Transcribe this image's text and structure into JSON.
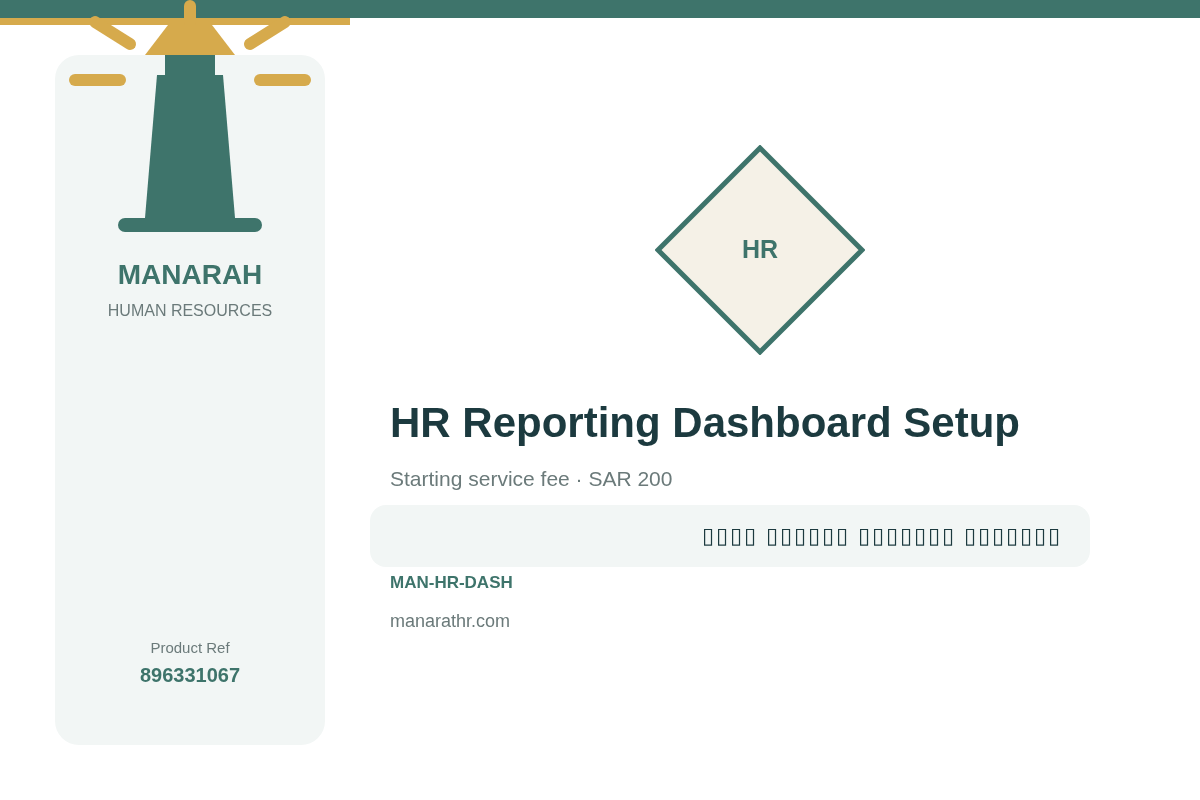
{
  "brand": {
    "name": "MANARAH",
    "tagline": "HUMAN RESOURCES"
  },
  "product_ref": {
    "label": "Product Ref",
    "value": "896331067"
  },
  "badge": {
    "text": "HR"
  },
  "title": "HR Reporting Dashboard Setup",
  "subtitle": "Starting service fee · SAR 200",
  "arabic_banner": "▯▯▯▯ ▯▯▯▯▯▯ ▯▯▯▯▯▯▯ ▯▯▯▯▯▯▯",
  "sku": "MAN-HR-DASH",
  "website": "manarathr.com"
}
